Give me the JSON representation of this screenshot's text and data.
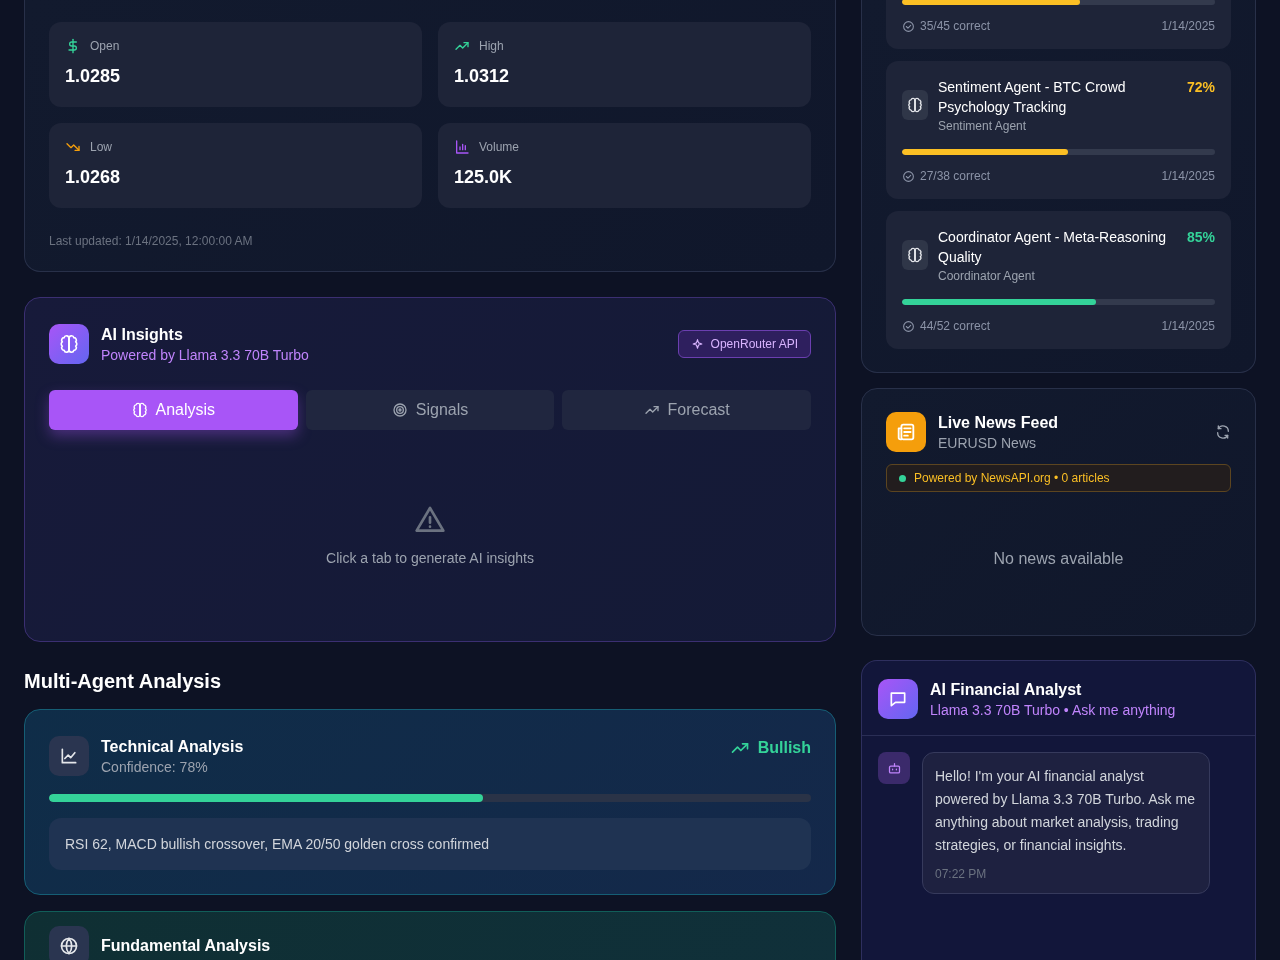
{
  "market": {
    "stats": [
      {
        "kind": "open",
        "label": "Open",
        "value": "1.0285"
      },
      {
        "kind": "high",
        "label": "High",
        "value": "1.0312"
      },
      {
        "kind": "low",
        "label": "Low",
        "value": "1.0268"
      },
      {
        "kind": "volume",
        "label": "Volume",
        "value": "125.0K"
      }
    ],
    "updated": "Last updated: 1/14/2025, 12:00:00 AM"
  },
  "insights": {
    "title": "AI Insights",
    "subtitle": "Powered by Llama 3.3 70B Turbo",
    "badge": "OpenRouter API",
    "tabs": [
      {
        "kind": "analysis",
        "label": "Analysis",
        "selected": true
      },
      {
        "kind": "signals",
        "label": "Signals",
        "selected": false
      },
      {
        "kind": "forecast",
        "label": "Forecast",
        "selected": false
      }
    ],
    "empty": "Click a tab to generate AI insights"
  },
  "multi_agent": {
    "heading": "Multi-Agent Analysis",
    "cards": [
      {
        "kind": "technical",
        "title": "Technical Analysis",
        "confidence": "Confidence: 78%",
        "signal": "Bullish",
        "level": 0.57,
        "summary": "RSI 62, MACD bullish crossover, EMA 20/50 golden cross confirmed"
      },
      {
        "kind": "fundamental",
        "title": "Fundamental Analysis"
      }
    ]
  },
  "agents": [
    {
      "level": 0.57,
      "color": "#fbbf24",
      "correct": "35/45 correct",
      "date": "1/14/2025"
    },
    {
      "name": "Sentiment Agent - BTC Crowd Psychology Tracking",
      "role": "Sentiment Agent",
      "percent": "72%",
      "level": 0.53,
      "color": "#fbbf24",
      "correct": "27/38 correct",
      "date": "1/14/2025"
    },
    {
      "name": "Coordinator Agent - Meta-Reasoning Quality",
      "role": "Coordinator Agent",
      "percent": "85%",
      "level": 0.62,
      "color": "#34d399",
      "correct": "44/52 correct",
      "date": "1/14/2025"
    }
  ],
  "news": {
    "title": "Live News Feed",
    "subtitle": "EURUSD News",
    "status": "Powered by NewsAPI.org • 0 articles",
    "empty": "No news available"
  },
  "chat": {
    "title": "AI Financial Analyst",
    "subtitle": "Llama 3.3 70B Turbo • Ask me anything",
    "messages": [
      {
        "text": "Hello! I'm your AI financial analyst powered by Llama 3.3 70B Turbo. Ask me anything about market analysis, trading strategies, or financial insights.",
        "time": "07:22 PM"
      }
    ]
  }
}
